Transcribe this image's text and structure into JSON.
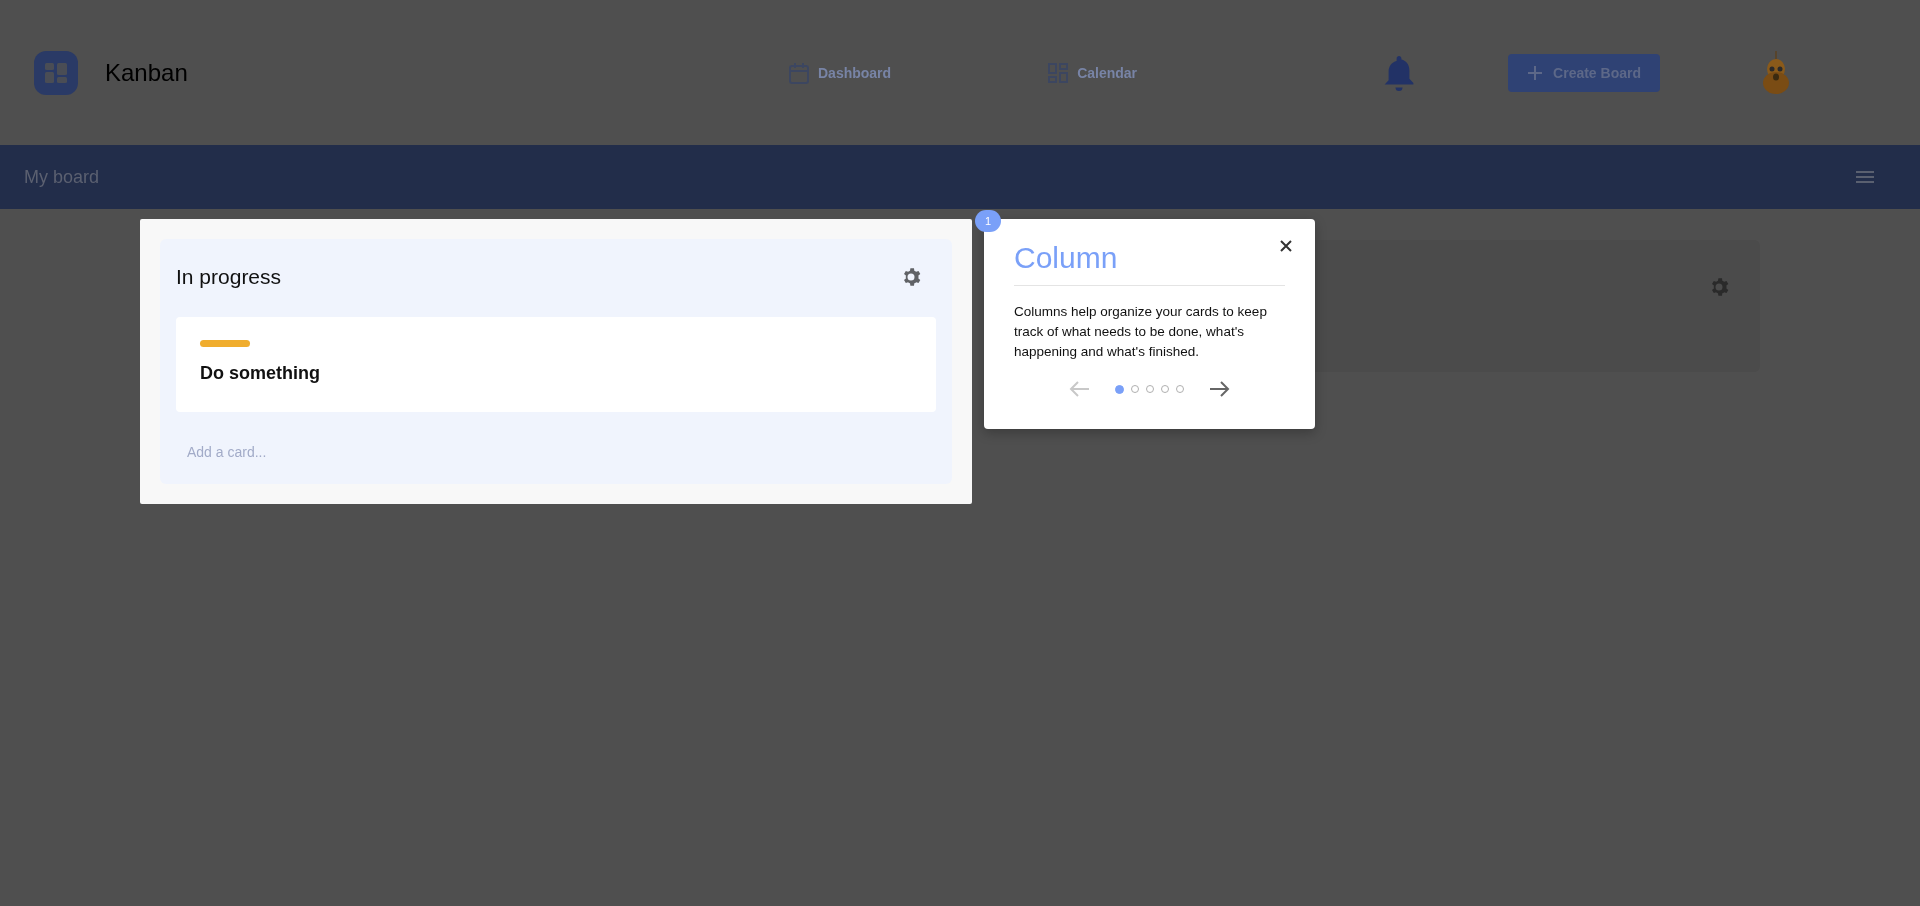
{
  "app": {
    "title": "Kanban"
  },
  "nav": [
    {
      "label": "Dashboard",
      "kind": "calendar"
    },
    {
      "label": "Calendar",
      "kind": "grid"
    }
  ],
  "create_button": {
    "label": "Create Board"
  },
  "board": {
    "title": "My board"
  },
  "columns": [
    {
      "title": "In progress",
      "highlighted": true,
      "cards": [
        {
          "title": "Do something",
          "color": "#f0ad2e"
        }
      ],
      "add_card": {
        "placeholder": "Add a card..."
      }
    },
    {
      "highlighted": false
    }
  ],
  "tour": {
    "step": "1",
    "title": "Column",
    "text": "Columns help organize your cards to keep track of what needs to be done, what's happening and what's finished.",
    "back": {
      "disabled": true
    },
    "next": {
      "disabled": false
    },
    "steps": [
      {
        "selected": true
      },
      {
        "selected": false
      },
      {
        "selected": false
      },
      {
        "selected": false
      },
      {
        "selected": false
      }
    ]
  }
}
